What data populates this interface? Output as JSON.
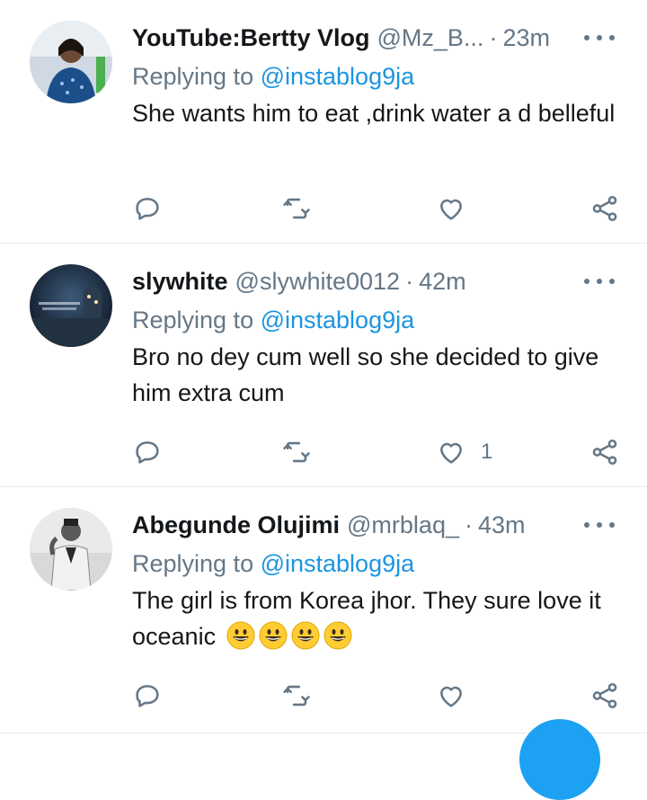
{
  "tweets": [
    {
      "name": "YouTube:Bertty Vlog",
      "handle": "@Mz_B...",
      "sep": "·",
      "time": "23m",
      "replying_prefix": "Replying to ",
      "mention": "@instablog9ja",
      "text": "She wants him to eat ,drink water a d belleful",
      "like_count": ""
    },
    {
      "name": "slywhite",
      "handle": "@slywhite0012",
      "sep": "·",
      "time": "42m",
      "replying_prefix": "Replying to ",
      "mention": "@instablog9ja",
      "text": "Bro no dey cum well so she decided to give him extra cum",
      "like_count": "1"
    },
    {
      "name": "Abegunde Olujimi",
      "handle": "@mrblaq_",
      "sep": "·",
      "time": "43m",
      "replying_prefix": "Replying to ",
      "mention": "@instablog9ja",
      "text": "The girl is from Korea jhor. They sure love it oceanic",
      "like_count": ""
    }
  ],
  "colors": {
    "muted": "#657786",
    "link": "#1b95e0",
    "divider": "#e6ecf0",
    "fab": "#1da1f2"
  },
  "icons": [
    "reply-icon",
    "retweet-icon",
    "like-icon",
    "share-icon",
    "more-icon",
    "grinning-face-emoji"
  ]
}
